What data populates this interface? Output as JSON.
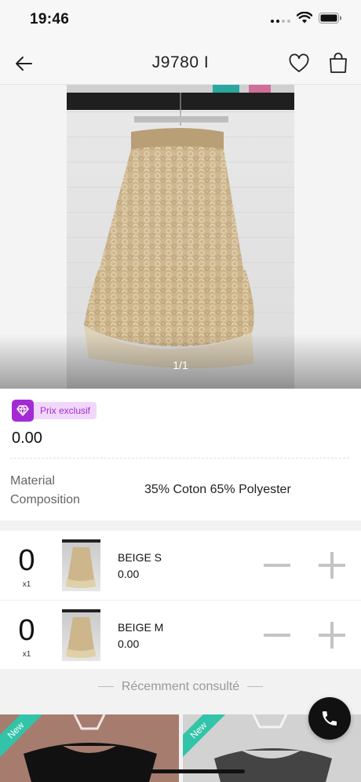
{
  "status_bar": {
    "time": "19:46",
    "icons": [
      "signal-icon",
      "wifi-icon",
      "battery-icon"
    ]
  },
  "nav": {
    "title": "J9780 I",
    "icons": [
      "back-arrow-icon",
      "heart-icon",
      "shopping-bag-icon"
    ]
  },
  "gallery": {
    "counter": "1/1"
  },
  "product": {
    "badge_label": "Prix exclusif",
    "badge_color": "#a42bd4",
    "price": "0.00",
    "material_label": "Material Composition",
    "material_value": "35% Coton 65% Polyester"
  },
  "variants": [
    {
      "quantity": "0",
      "multiplier": "x1",
      "name": "BEIGE S",
      "price": "0.00"
    },
    {
      "quantity": "0",
      "multiplier": "x1",
      "name": "BEIGE M",
      "price": "0.00"
    }
  ],
  "recent": {
    "heading": "Récemment consulté",
    "items": [
      {
        "badge": "New"
      },
      {
        "badge": "New"
      }
    ]
  },
  "colors": {
    "new_badge": "#32c4a9",
    "call_button": "#111111"
  }
}
